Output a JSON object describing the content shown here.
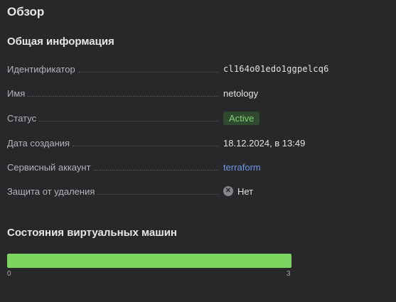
{
  "page_title": "Обзор",
  "general": {
    "title": "Общая информация",
    "rows": {
      "id": {
        "label": "Идентификатор",
        "value": "cl164o01edo1ggpelcq6"
      },
      "name": {
        "label": "Имя",
        "value": "netology"
      },
      "status": {
        "label": "Статус",
        "value": "Active",
        "color": "#7fd36f"
      },
      "created": {
        "label": "Дата создания",
        "value": "18.12.2024, в 13:49"
      },
      "service_account": {
        "label": "Сервисный аккаунт",
        "value": "terraform",
        "color": "#6a98e8"
      },
      "deletion_protection": {
        "label": "Защита от удаления",
        "value": "Нет",
        "icon": "x-circle-icon"
      }
    }
  },
  "vm_states": {
    "title": "Состояния виртуальных машин",
    "progress": {
      "value": 3,
      "max": 3,
      "fraction": 1.0,
      "color": "#7cd55f"
    },
    "scale_min": "0",
    "scale_max": "3"
  }
}
